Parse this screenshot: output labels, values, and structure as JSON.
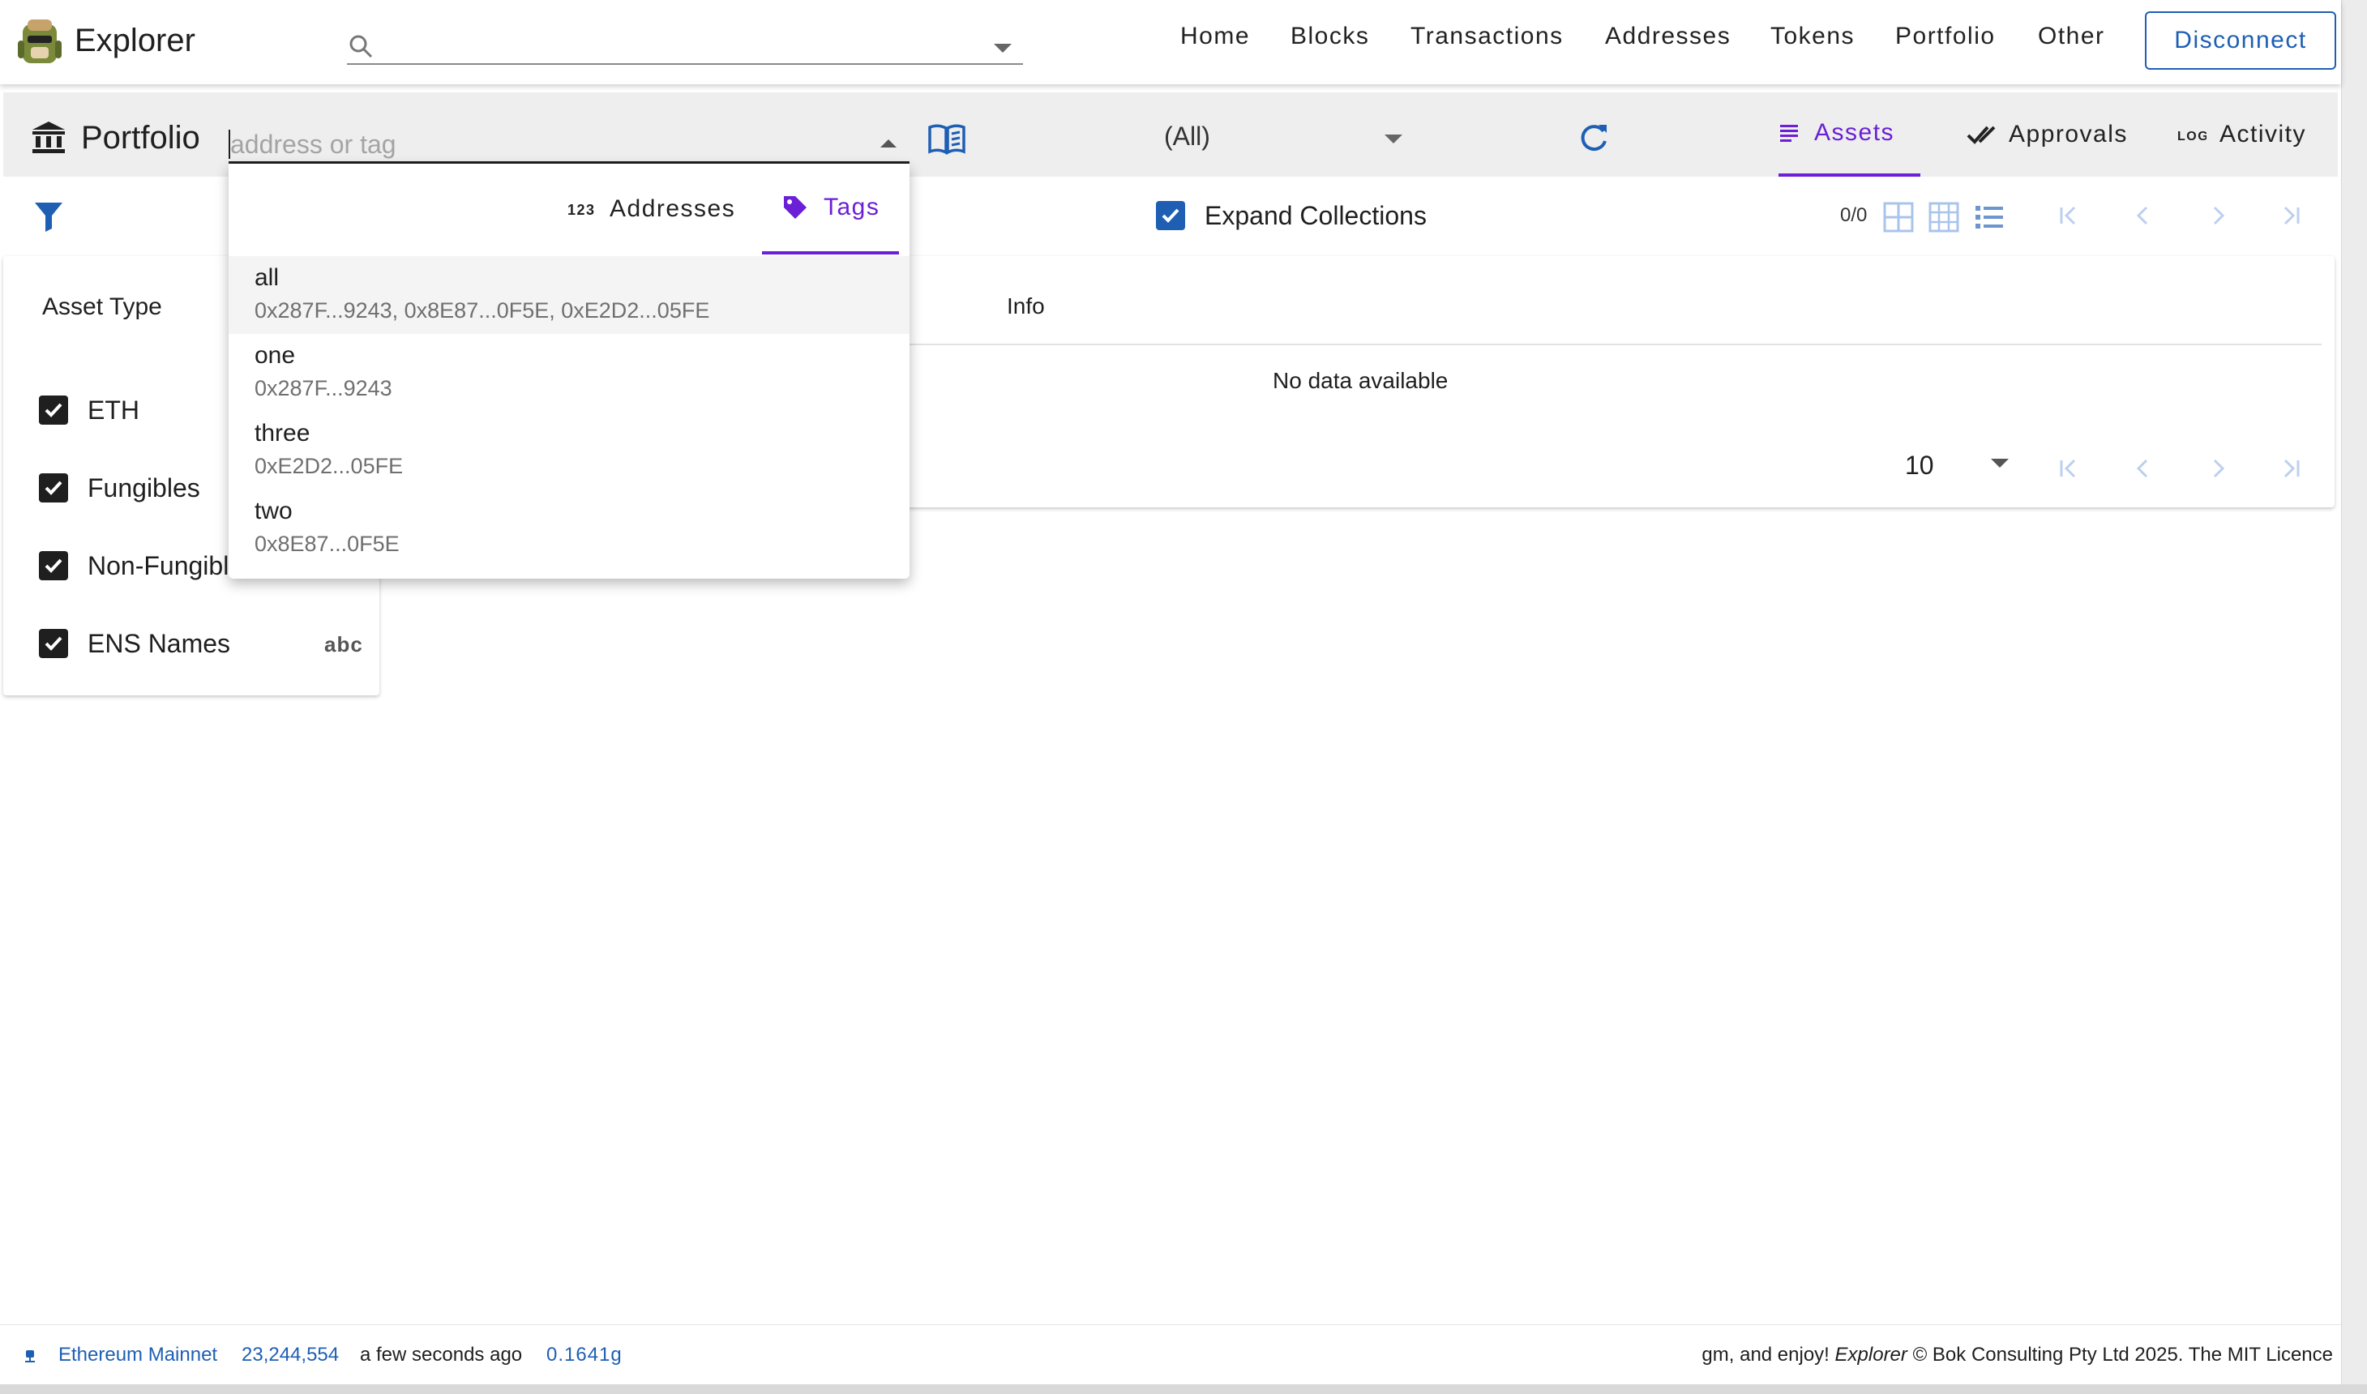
{
  "app": {
    "title": "Explorer"
  },
  "search": {
    "placeholder": "",
    "value": ""
  },
  "nav": [
    {
      "label": "Home"
    },
    {
      "label": "Blocks"
    },
    {
      "label": "Transactions"
    },
    {
      "label": "Addresses"
    },
    {
      "label": "Tokens"
    },
    {
      "label": "Portfolio"
    },
    {
      "label": "Other"
    }
  ],
  "disconnect_label": "Disconnect",
  "portfolio": {
    "title": "Portfolio",
    "address_placeholder": "address or tag",
    "select_value": "(All)",
    "tabs": [
      {
        "label": "Assets",
        "icon": "list-icon",
        "active": true
      },
      {
        "label": "Approvals",
        "icon": "check-icon",
        "active": false
      },
      {
        "label": "Activity",
        "icon": "log-icon",
        "active": false
      }
    ],
    "expand_collections_label": "Expand Collections",
    "expand_collections_checked": true,
    "count": "0/0"
  },
  "dropdown": {
    "tabs": [
      {
        "label": "Addresses",
        "icon": "numbers-icon",
        "active": false
      },
      {
        "label": "Tags",
        "icon": "tag-icon",
        "active": true
      }
    ],
    "items": [
      {
        "name": "all",
        "addresses": "0x287F...9243, 0x8E87...0F5E, 0xE2D2...05FE",
        "highlighted": true
      },
      {
        "name": "one",
        "addresses": "0x287F...9243"
      },
      {
        "name": "three",
        "addresses": "0xE2D2...05FE"
      },
      {
        "name": "two",
        "addresses": "0x8E87...0F5E"
      }
    ]
  },
  "filters": {
    "title": "Asset Type",
    "items": [
      {
        "label": "ETH",
        "checked": true,
        "icon_text": ""
      },
      {
        "label": "Fungibles",
        "checked": true,
        "icon_text": ""
      },
      {
        "label": "Non-Fungibl",
        "checked": true,
        "icon_text": ""
      },
      {
        "label": "ENS Names",
        "checked": true,
        "icon_text": "abc"
      }
    ]
  },
  "table": {
    "columns": [
      "Info"
    ],
    "empty_text": "No data available",
    "per_page": "10"
  },
  "footer": {
    "network": "Ethereum Mainnet",
    "block": "23,244,554",
    "time": "a few seconds ago",
    "gas": "0.1641g",
    "right_prefix": "gm, and enjoy! ",
    "right_brand": "Explorer",
    "right_suffix": " © Bok Consulting Pty Ltd 2025. The MIT Licence"
  },
  "colors": {
    "accent": "#6b1fd6",
    "primary": "#1e5fb4"
  }
}
